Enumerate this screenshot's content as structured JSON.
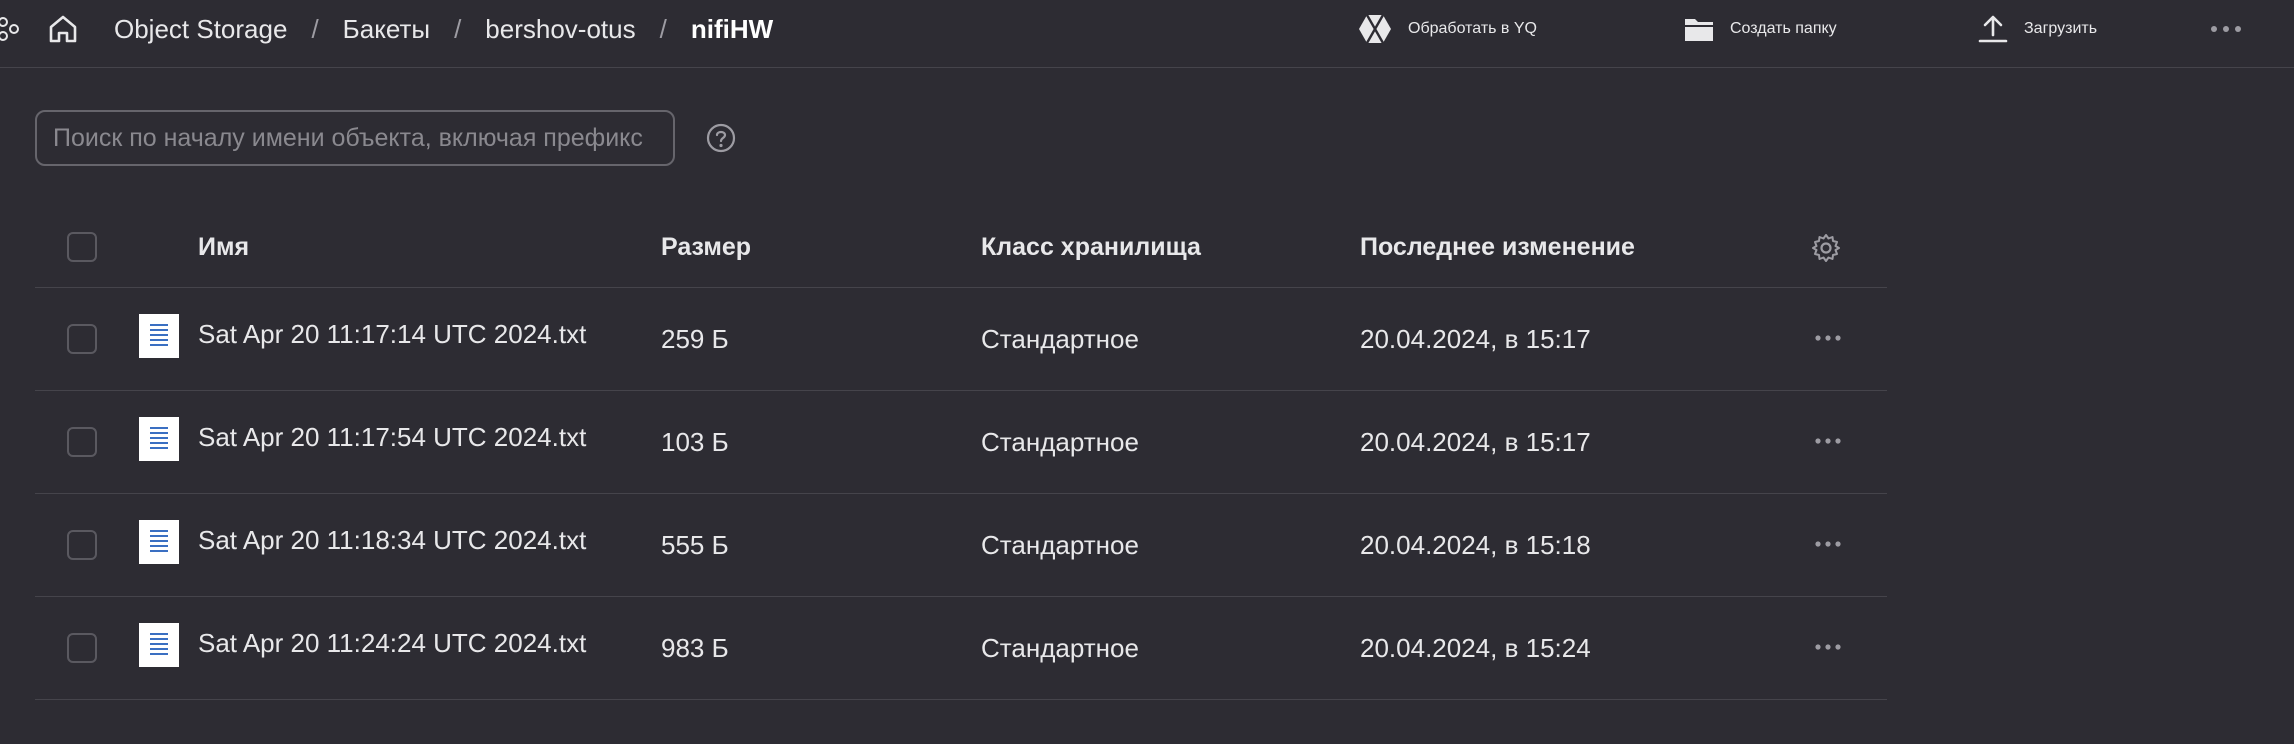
{
  "breadcrumbs": {
    "items": [
      "Object Storage",
      "Бакеты",
      "bershov-otus"
    ],
    "current": "nifiHW",
    "separator": "/"
  },
  "toolbar": {
    "process_yq": "Обработать в YQ",
    "create_folder": "Создать папку",
    "upload": "Загрузить"
  },
  "search": {
    "placeholder": "Поиск по началу имени объекта, включая префикс"
  },
  "table": {
    "columns": {
      "name": "Имя",
      "size": "Размер",
      "storage_class": "Класс хранилища",
      "modified": "Последнее изменение"
    },
    "rows": [
      {
        "name": "Sat Apr 20 11:17:14 UTC 2024.txt",
        "size": "259 Б",
        "storage_class": "Стандартное",
        "modified": "20.04.2024, в 15:17"
      },
      {
        "name": "Sat Apr 20 11:17:54 UTC 2024.txt",
        "size": "103 Б",
        "storage_class": "Стандартное",
        "modified": "20.04.2024, в 15:17"
      },
      {
        "name": "Sat Apr 20 11:18:34 UTC 2024.txt",
        "size": "555 Б",
        "storage_class": "Стандартное",
        "modified": "20.04.2024, в 15:18"
      },
      {
        "name": "Sat Apr 20 11:24:24 UTC 2024.txt",
        "size": "983 Б",
        "storage_class": "Стандартное",
        "modified": "20.04.2024, в 15:24"
      }
    ]
  },
  "icons": {
    "services": "services-icon",
    "home": "home-icon",
    "yq": "yq-icon",
    "folder": "folder-icon",
    "upload": "upload-icon",
    "more": "more-horizontal-icon",
    "help": "help-circle-icon",
    "settings": "gear-icon",
    "file": "text-file-icon"
  },
  "colors": {
    "background": "#2d2c33",
    "text": "#e8e8ea",
    "divider": "#45444b",
    "file_icon_lines": "#3a6fc2"
  }
}
